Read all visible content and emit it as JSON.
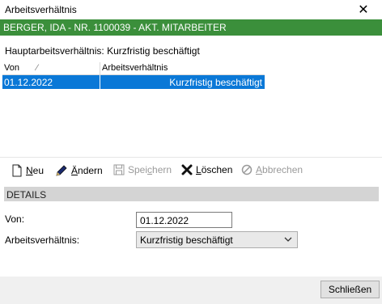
{
  "window": {
    "title": "Arbeitsverhältnis",
    "close_glyph": "✕"
  },
  "banner": {
    "text": "BERGER, IDA - NR. 1100039 - AKT. MITARBEITER",
    "color": "#3b8f3b"
  },
  "main": {
    "haupt_label": "Hauptarbeitsverhältnis: Kurzfristig beschäftigt"
  },
  "grid": {
    "columns": [
      "Von",
      "Arbeitsverhältnis"
    ],
    "sort_indicator": "⁄",
    "rows": [
      {
        "von": "01.12.2022",
        "arbeitsverhaeltnis": "Kurzfristig beschäftigt",
        "selected": true
      }
    ],
    "selection_color": "#0a78d7"
  },
  "toolbar": {
    "neu": {
      "pre": "",
      "u": "N",
      "post": "eu",
      "icon": "new-document-icon"
    },
    "aendern": {
      "pre": "",
      "u": "Ä",
      "post": "ndern",
      "icon": "pencil-icon"
    },
    "speichern": {
      "pre": "Spei",
      "u": "c",
      "post": "hern",
      "icon": "save-icon",
      "disabled": true
    },
    "loeschen": {
      "pre": "",
      "u": "L",
      "post": "öschen",
      "icon": "delete-x-icon"
    },
    "abbrechen": {
      "pre": "",
      "u": "A",
      "post": "bbrechen",
      "icon": "cancel-icon",
      "disabled": true
    }
  },
  "details": {
    "header": "DETAILS",
    "von_label": "Von:",
    "von_value": "01.12.2022",
    "av_label": "Arbeitsverhältnis:",
    "av_value": "Kurzfristig beschäftigt"
  },
  "footer": {
    "close_button": "Schließen"
  }
}
